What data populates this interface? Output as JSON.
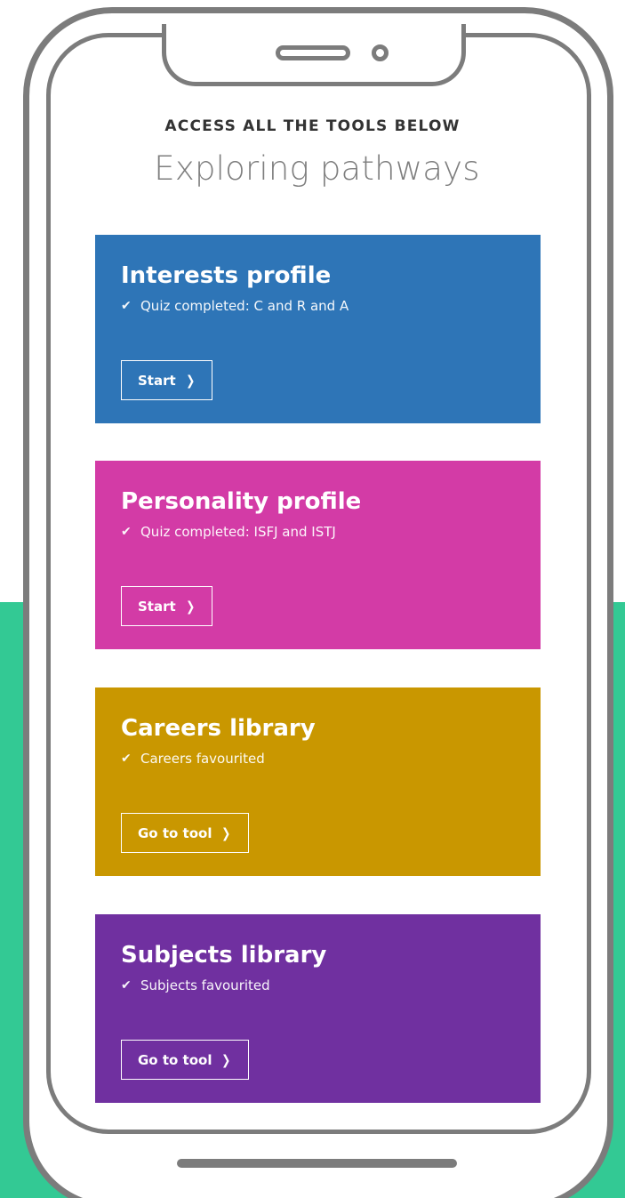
{
  "colors": {
    "background": "#ffffff",
    "accent_band": "#33c994",
    "device_outline": "#7c7c7c",
    "eyebrow_text": "#333333",
    "headline_text": "#7e7e7e"
  },
  "header": {
    "eyebrow": "ACCESS ALL THE TOOLS BELOW",
    "title": "Exploring pathways"
  },
  "cards": [
    {
      "title": "Interests profile",
      "status": "Quiz completed: C and R and A",
      "status_icon": "check-icon",
      "button_label": "Start",
      "button_icon": "chevron-right-icon",
      "color": "#2e75b7"
    },
    {
      "title": "Personality profile",
      "status": "Quiz completed: ISFJ and ISTJ",
      "status_icon": "check-icon",
      "button_label": "Start",
      "button_icon": "chevron-right-icon",
      "color": "#d33ba6"
    },
    {
      "title": "Careers library",
      "status": "Careers favourited",
      "status_icon": "check-icon",
      "button_label": "Go to tool",
      "button_icon": "chevron-right-icon",
      "color": "#c99700"
    },
    {
      "title": "Subjects library",
      "status": "Subjects favourited",
      "status_icon": "check-icon",
      "button_label": "Go to tool",
      "button_icon": "chevron-right-icon",
      "color": "#7030a0"
    }
  ]
}
